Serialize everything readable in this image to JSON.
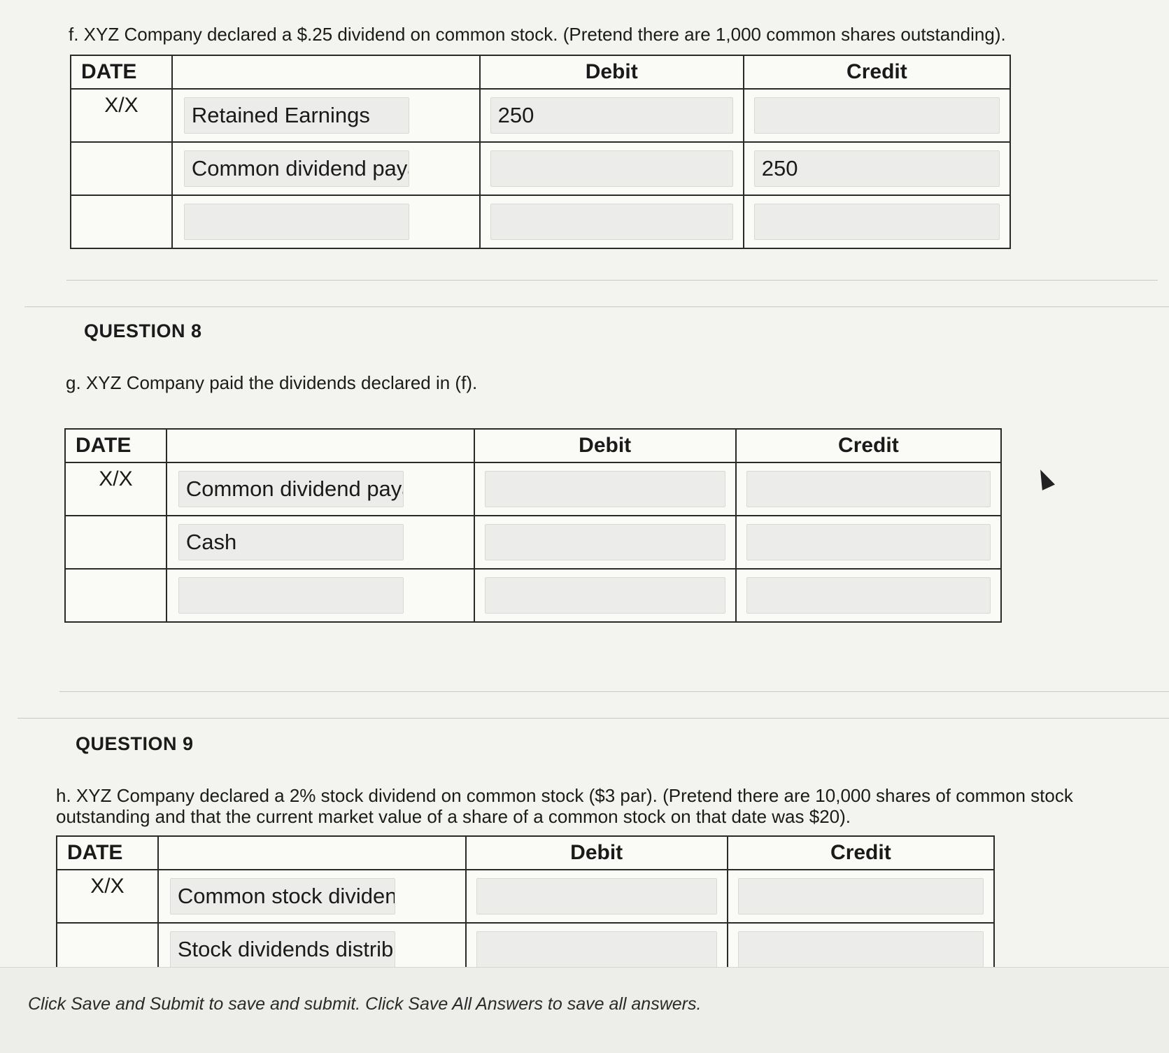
{
  "question_f": {
    "text": "f. XYZ Company declared a $.25 dividend on common stock. (Pretend there are 1,000 common shares outstanding).",
    "headers": {
      "date": "DATE",
      "account": "",
      "debit": "Debit",
      "credit": "Credit"
    },
    "rows": [
      {
        "date": "X/X",
        "account": "Retained Earnings",
        "debit": "250",
        "credit": ""
      },
      {
        "date": "",
        "account": "Common dividend paya",
        "debit": "",
        "credit": "250"
      },
      {
        "date": "",
        "account": "",
        "debit": "",
        "credit": ""
      }
    ]
  },
  "question_8": {
    "title": "QUESTION 8",
    "text": "g. XYZ Company paid the dividends declared in (f).",
    "headers": {
      "date": "DATE",
      "account": "",
      "debit": "Debit",
      "credit": "Credit"
    },
    "rows": [
      {
        "date": "X/X",
        "account": "Common dividend paya",
        "debit": "",
        "credit": ""
      },
      {
        "date": "",
        "account": "Cash",
        "debit": "",
        "credit": ""
      },
      {
        "date": "",
        "account": "",
        "debit": "",
        "credit": ""
      }
    ]
  },
  "question_9": {
    "title": "QUESTION 9",
    "text": "h. XYZ Company declared a 2% stock dividend on common stock ($3 par). (Pretend there are 10,000 shares of common stock outstanding and that the current market value of a share of a common stock on that date was $20).",
    "headers": {
      "date": "DATE",
      "account": "",
      "debit": "Debit",
      "credit": "Credit"
    },
    "rows": [
      {
        "date": "X/X",
        "account": "Common stock dividenc",
        "debit": "",
        "credit": ""
      },
      {
        "date": "",
        "account": "Stock dividends distribu",
        "debit": "",
        "credit": ""
      }
    ]
  },
  "footer": {
    "text": "Click Save and Submit to save and submit. Click Save All Answers to save all answers."
  }
}
